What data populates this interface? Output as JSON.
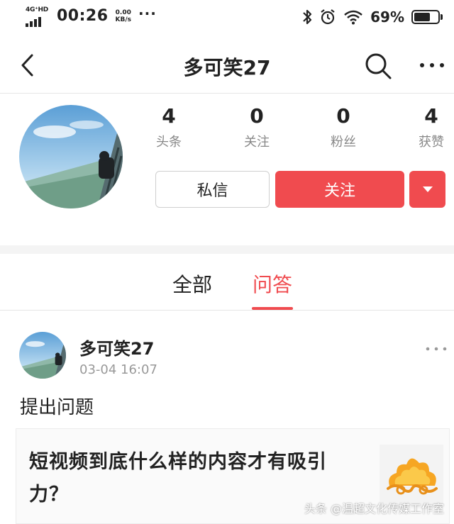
{
  "status_bar": {
    "network": "4G⁺HD",
    "time": "00:26",
    "speed_value": "0.00",
    "speed_unit": "KB/s",
    "more": "···",
    "battery_text": "69%",
    "battery_level": 0.69,
    "icons": [
      "bluetooth-icon",
      "alarm-icon",
      "wifi-icon",
      "battery-icon"
    ]
  },
  "nav": {
    "title": "多可笑27",
    "icons": [
      "back-arrow-icon",
      "search-icon",
      "more-icon"
    ]
  },
  "profile": {
    "stats": [
      {
        "value": "4",
        "label": "头条"
      },
      {
        "value": "0",
        "label": "关注"
      },
      {
        "value": "0",
        "label": "粉丝"
      },
      {
        "value": "4",
        "label": "获赞"
      }
    ],
    "message_label": "私信",
    "follow_label": "关注",
    "accent_color": "#f04b4f"
  },
  "tabs": [
    {
      "label": "全部",
      "active": false
    },
    {
      "label": "问答",
      "active": true
    }
  ],
  "post": {
    "author": "多可笑27",
    "time": "03-04 16:07",
    "action": "提出问题",
    "question_title": "短视频到底什么样的内容才有吸引力？"
  },
  "watermark": "头条 @温超文化传媒工作室"
}
